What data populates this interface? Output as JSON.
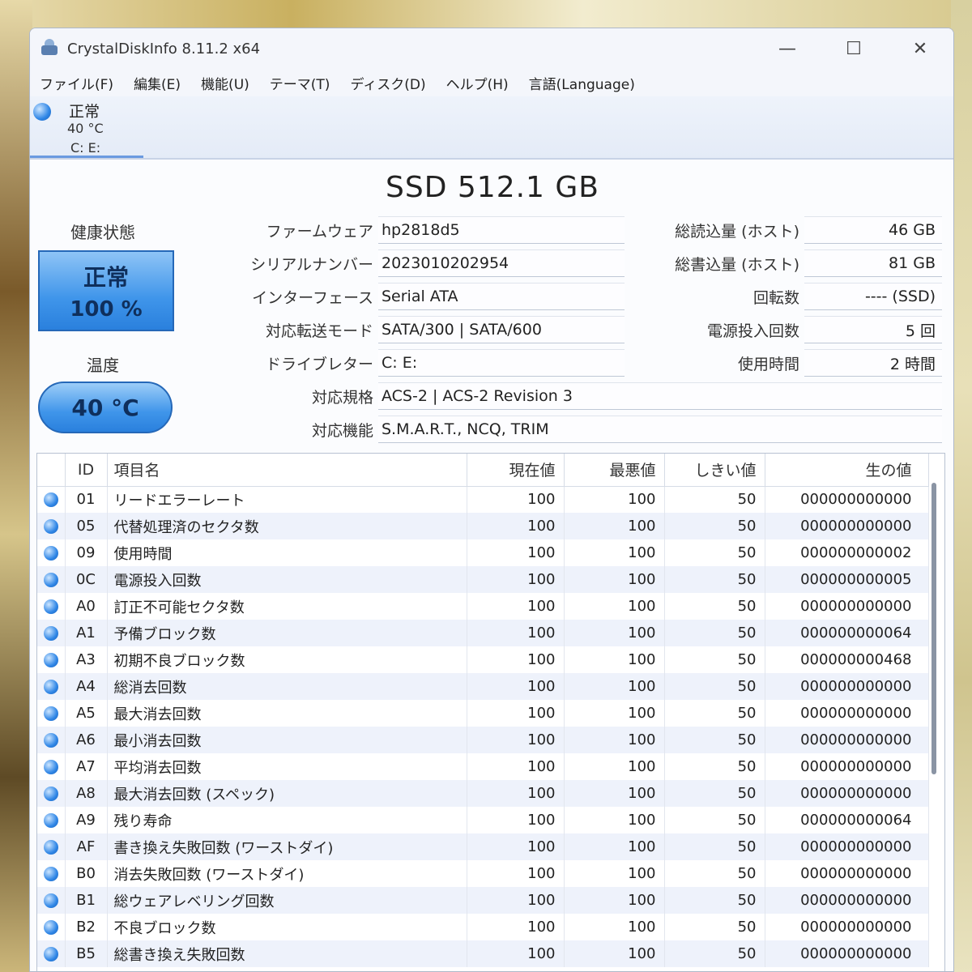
{
  "window": {
    "title": "CrystalDiskInfo 8.11.2 x64"
  },
  "window_controls": {
    "minimize": "—",
    "maximize": "☐",
    "close": "✕"
  },
  "menu": [
    "ファイル(F)",
    "編集(E)",
    "機能(U)",
    "テーマ(T)",
    "ディスク(D)",
    "ヘルプ(H)",
    "言語(Language)"
  ],
  "drive_tab": {
    "status": "正常",
    "temp": "40 °C",
    "letters": "C: E:"
  },
  "disk_title": "SSD 512.1 GB",
  "health": {
    "label": "健康状態",
    "status": "正常",
    "percent": "100 %"
  },
  "temperature": {
    "label": "温度",
    "value": "40 °C"
  },
  "info_left": [
    {
      "label": "ファームウェア",
      "value": "hp2818d5"
    },
    {
      "label": "シリアルナンバー",
      "value": "2023010202954"
    },
    {
      "label": "インターフェース",
      "value": "Serial ATA"
    },
    {
      "label": "対応転送モード",
      "value": "SATA/300 | SATA/600"
    },
    {
      "label": "ドライブレター",
      "value": "C: E:"
    }
  ],
  "info_right": [
    {
      "label": "総読込量 (ホスト)",
      "value": "46 GB"
    },
    {
      "label": "総書込量 (ホスト)",
      "value": "81 GB"
    },
    {
      "label": "回転数",
      "value": "---- (SSD)"
    },
    {
      "label": "電源投入回数",
      "value": "5 回"
    },
    {
      "label": "使用時間",
      "value": "2 時間"
    }
  ],
  "info_wide": [
    {
      "label": "対応規格",
      "value": "ACS-2 | ACS-2 Revision 3"
    },
    {
      "label": "対応機能",
      "value": "S.M.A.R.T., NCQ, TRIM"
    }
  ],
  "smart": {
    "headers": {
      "id": "ID",
      "name": "項目名",
      "current": "現在値",
      "worst": "最悪値",
      "threshold": "しきい値",
      "raw": "生の値"
    },
    "rows": [
      {
        "id": "01",
        "name": "リードエラーレート",
        "current": "100",
        "worst": "100",
        "threshold": "50",
        "raw": "000000000000"
      },
      {
        "id": "05",
        "name": "代替処理済のセクタ数",
        "current": "100",
        "worst": "100",
        "threshold": "50",
        "raw": "000000000000"
      },
      {
        "id": "09",
        "name": "使用時間",
        "current": "100",
        "worst": "100",
        "threshold": "50",
        "raw": "000000000002"
      },
      {
        "id": "0C",
        "name": "電源投入回数",
        "current": "100",
        "worst": "100",
        "threshold": "50",
        "raw": "000000000005"
      },
      {
        "id": "A0",
        "name": "訂正不可能セクタ数",
        "current": "100",
        "worst": "100",
        "threshold": "50",
        "raw": "000000000000"
      },
      {
        "id": "A1",
        "name": "予備ブロック数",
        "current": "100",
        "worst": "100",
        "threshold": "50",
        "raw": "000000000064"
      },
      {
        "id": "A3",
        "name": "初期不良ブロック数",
        "current": "100",
        "worst": "100",
        "threshold": "50",
        "raw": "000000000468"
      },
      {
        "id": "A4",
        "name": "総消去回数",
        "current": "100",
        "worst": "100",
        "threshold": "50",
        "raw": "000000000000"
      },
      {
        "id": "A5",
        "name": "最大消去回数",
        "current": "100",
        "worst": "100",
        "threshold": "50",
        "raw": "000000000000"
      },
      {
        "id": "A6",
        "name": "最小消去回数",
        "current": "100",
        "worst": "100",
        "threshold": "50",
        "raw": "000000000000"
      },
      {
        "id": "A7",
        "name": "平均消去回数",
        "current": "100",
        "worst": "100",
        "threshold": "50",
        "raw": "000000000000"
      },
      {
        "id": "A8",
        "name": "最大消去回数 (スペック)",
        "current": "100",
        "worst": "100",
        "threshold": "50",
        "raw": "000000000000"
      },
      {
        "id": "A9",
        "name": "残り寿命",
        "current": "100",
        "worst": "100",
        "threshold": "50",
        "raw": "000000000064"
      },
      {
        "id": "AF",
        "name": "書き換え失敗回数 (ワーストダイ)",
        "current": "100",
        "worst": "100",
        "threshold": "50",
        "raw": "000000000000"
      },
      {
        "id": "B0",
        "name": "消去失敗回数 (ワーストダイ)",
        "current": "100",
        "worst": "100",
        "threshold": "50",
        "raw": "000000000000"
      },
      {
        "id": "B1",
        "name": "総ウェアレベリング回数",
        "current": "100",
        "worst": "100",
        "threshold": "50",
        "raw": "000000000000"
      },
      {
        "id": "B2",
        "name": "不良ブロック数",
        "current": "100",
        "worst": "100",
        "threshold": "50",
        "raw": "000000000000"
      },
      {
        "id": "B5",
        "name": "総書き換え失敗回数",
        "current": "100",
        "worst": "100",
        "threshold": "50",
        "raw": "000000000000"
      }
    ]
  },
  "colors": {
    "status_good": "#3f95ea",
    "accent": "#2a80dd"
  }
}
